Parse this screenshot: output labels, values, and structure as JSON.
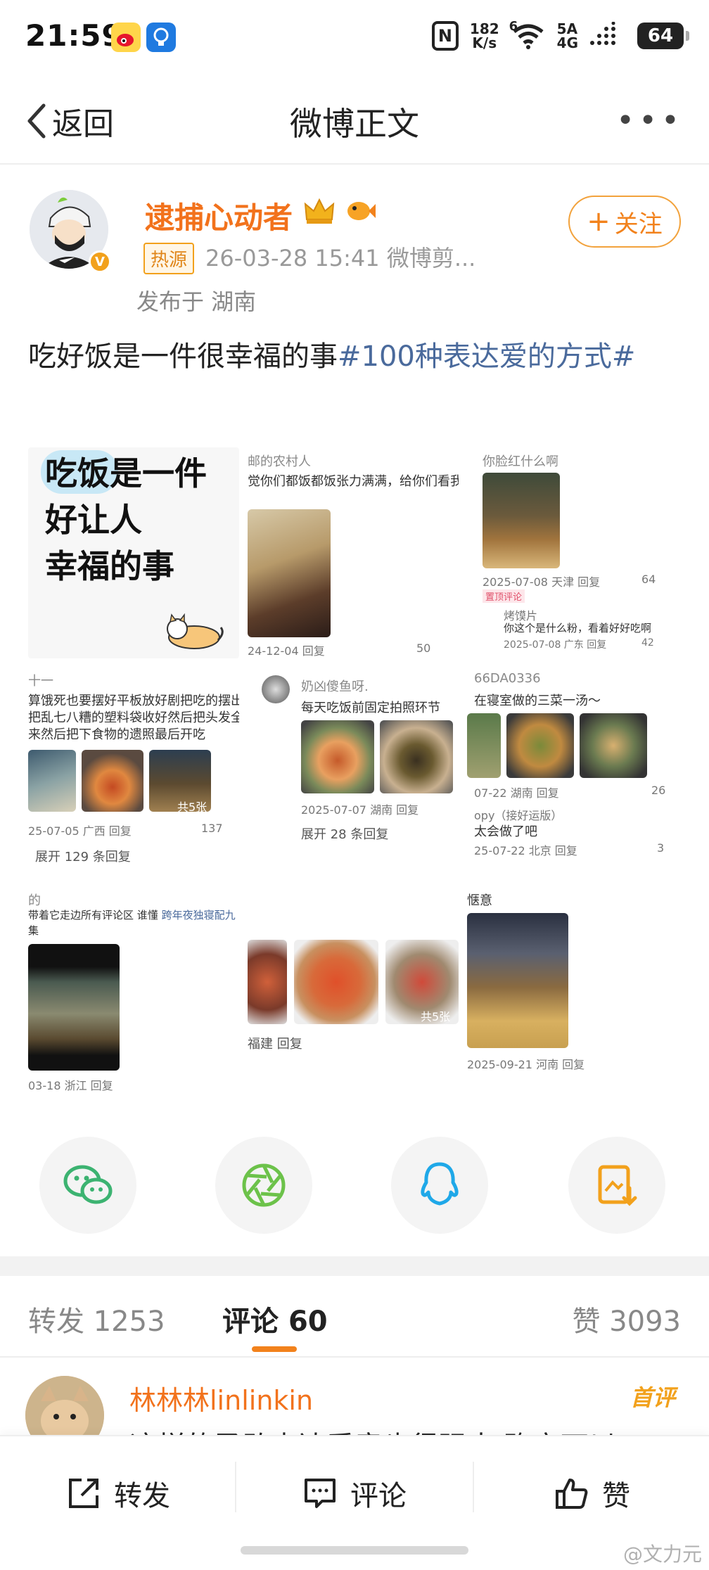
{
  "status_bar": {
    "time": "21:59",
    "speed_value": "182",
    "speed_unit": "K/s",
    "wifi": "6",
    "net_top": "5A",
    "net_bottom": "4G",
    "battery": "64"
  },
  "nav": {
    "back_label": "返回",
    "title": "微博正文"
  },
  "author": {
    "name": "逮捕心动者",
    "source_tag": "热源",
    "meta": "26-03-28 15:41  微博剪...",
    "location": "发布于 湖南",
    "follow_label": "关注",
    "verified_color": "#f2a11c"
  },
  "post": {
    "text": "吃好饭是一件很幸福的事",
    "topic": "#100种表达爱的方式#"
  },
  "grid": {
    "cell0": {
      "line1": "吃饭是一件",
      "line2": "好让人",
      "line3": "幸福的事"
    },
    "cell1": {
      "top": "邮的农村人",
      "body": "觉你们都饭都饭张力满满，给你们看我们学",
      "meta": "24-12-04   回复",
      "likes": "50"
    },
    "cell2": {
      "top": "你脸红什么啊",
      "meta": "2025-07-08 天津   回复",
      "likes": "64",
      "badge": "置顶评论",
      "reply_user": "烤馍片",
      "reply_text": "你这个是什么粉，看着好好吃啊",
      "reply_meta": "2025-07-08 广东   回复",
      "reply_likes": "42"
    },
    "cell3": {
      "top": "十一",
      "body1": "算饿死也要摆好平板放好剧把吃的摆出",
      "body2": "把乱七八糟的塑料袋收好然后把头发全",
      "body3": "来然后把下食物的遗照最后开吃",
      "count": "共5张",
      "meta": "25-07-05 广西   回复",
      "likes": "137",
      "expand": "展开 129 条回复"
    },
    "cell4": {
      "user": "奶凶傻鱼呀.",
      "body": "每天吃饭前固定拍照环节",
      "meta": "2025-07-07 湖南   回复",
      "expand": "展开 28 条回复"
    },
    "cell5": {
      "top": "66DA0336",
      "body": "在寝室做的三菜一汤～",
      "meta": "07-22 湖南   回复",
      "likes": "26",
      "reply_user": "opy（接好运版）",
      "reply_text": "太会做了吧",
      "reply_meta": "25-07-22 北京   回复",
      "reply_likes": "3"
    },
    "cell6": {
      "top": "的",
      "body1": "带着它走边所有评论区 谁懂",
      "body_link": "跨年夜独寝配九",
      "body2": "集",
      "meta": "03-18 浙江   回复"
    },
    "cell7": {
      "count": "共5张",
      "meta": "福建   回复"
    },
    "cell8": {
      "top": "惬意",
      "meta": "2025-09-21 河南   回复"
    }
  },
  "share": {
    "icons": [
      "wechat-icon",
      "moments-icon",
      "qq-icon",
      "save-image-icon"
    ],
    "colors": {
      "wechat": "#3cb371",
      "moments": "#6cc24a",
      "qq": "#1fa8e8",
      "save": "#f2a11c"
    }
  },
  "tabs": {
    "repost_label": "转发",
    "repost_count": "1253",
    "comment_label": "评论",
    "comment_count": "60",
    "like_label": "赞",
    "like_count": "3093"
  },
  "comment": {
    "user": "林林林linlinkin",
    "tag": "首评",
    "text": "这样的勇敢表达爱意也很强大 确定可以"
  },
  "actions": {
    "repost": "转发",
    "comment": "评论",
    "like": "赞"
  },
  "watermark": "@文力元",
  "accent_color": "#f2821c"
}
